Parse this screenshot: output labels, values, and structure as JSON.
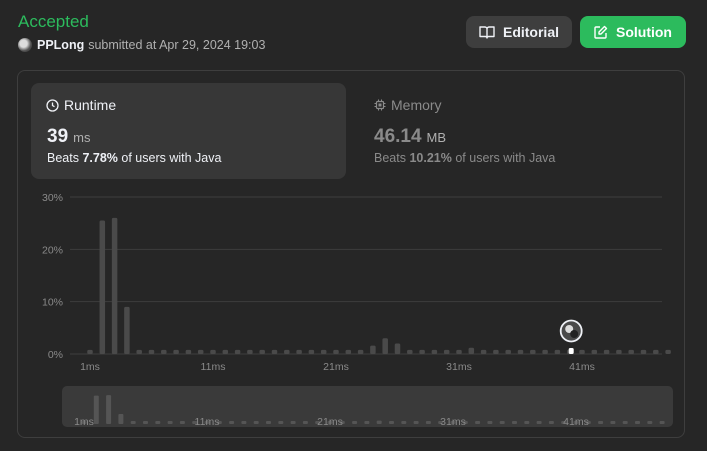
{
  "header": {
    "status": "Accepted",
    "user": "PPLong",
    "submitted_text": "submitted at Apr 29, 2024 19:03",
    "editorial_label": "Editorial",
    "solution_label": "Solution"
  },
  "runtime": {
    "label": "Runtime",
    "value": "39",
    "unit": "ms",
    "beats_prefix": "Beats",
    "beats_value": "7.78%",
    "beats_suffix": "of users with Java"
  },
  "memory": {
    "label": "Memory",
    "value": "46.14",
    "unit": "MB",
    "beats_prefix": "Beats",
    "beats_value": "10.21%",
    "beats_suffix": "of users with Java"
  },
  "colors": {
    "accepted": "#2cbb5d",
    "bar": "#4a4a4a",
    "grid": "#3e3e3e",
    "axis_text": "#8a8a8a"
  },
  "chart_data": {
    "type": "bar",
    "y_ticks": [
      "30%",
      "20%",
      "10%",
      "0%"
    ],
    "ylim": [
      0,
      30
    ],
    "x_ticks": [
      "1ms",
      "11ms",
      "21ms",
      "31ms",
      "41ms"
    ],
    "x_tick_indices": [
      0,
      10,
      20,
      30,
      40
    ],
    "values": [
      0.8,
      25.5,
      26,
      9,
      0.8,
      0.8,
      0.8,
      0.8,
      0.8,
      0.8,
      0.8,
      0.8,
      0.8,
      0.8,
      0.8,
      0.8,
      0.8,
      0.8,
      0.8,
      0.8,
      0.8,
      0.8,
      0.8,
      1.6,
      3,
      2,
      0.8,
      0.8,
      0.8,
      0.8,
      0.8,
      1.2,
      0.8,
      0.8,
      0.8,
      0.8,
      0.8,
      0.8,
      0.8,
      0.8,
      0.8,
      0.8,
      0.8,
      0.8,
      0.8,
      0.8,
      0.8,
      0.8
    ],
    "you_index": 39,
    "mini_x_ticks": [
      "1ms",
      "11ms",
      "21ms",
      "31ms",
      "41ms"
    ]
  }
}
